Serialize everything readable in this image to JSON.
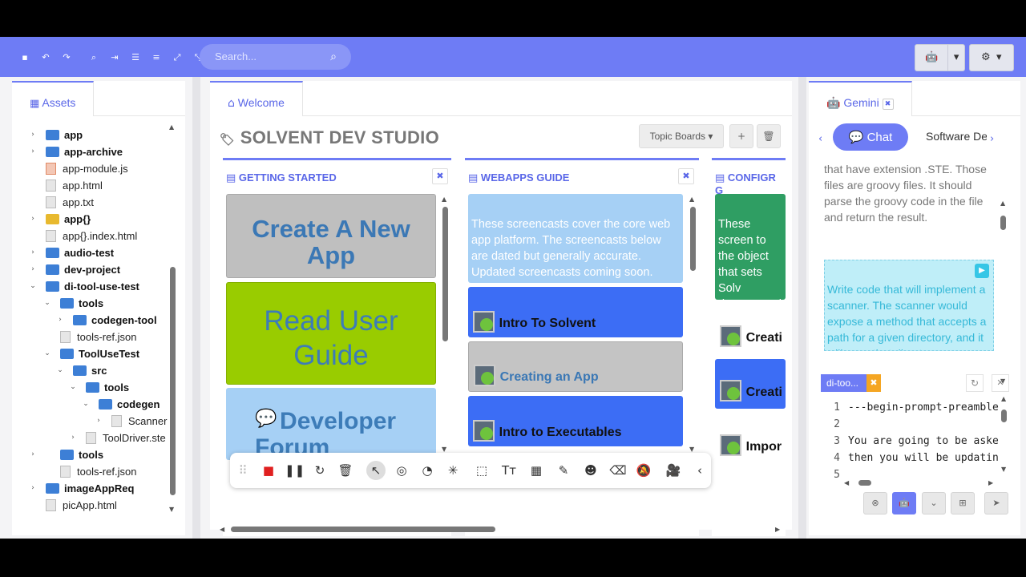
{
  "toolbar": {
    "icons": [
      "save-icon",
      "undo-icon",
      "redo-icon",
      "find-icon",
      "indent-icon",
      "align-left-icon",
      "align-justify-icon",
      "expand-icon",
      "collapse-icon"
    ],
    "icon_glyphs": [
      "▪",
      "↶",
      "↷",
      "⌕",
      "⇥",
      "☰",
      "≡",
      "⤢",
      "⤡"
    ],
    "search_placeholder": "Search...",
    "android_glyph": "🤖",
    "caret": "▾",
    "gear_glyph": "⚙"
  },
  "assets": {
    "tab_label": "Assets",
    "tree": [
      {
        "label": "app",
        "type": "folder",
        "bold": true,
        "arrow": "›"
      },
      {
        "label": "app-archive",
        "type": "folder",
        "bold": true,
        "arrow": "›"
      },
      {
        "label": "app-module.js",
        "type": "js",
        "bold": false,
        "arrow": ""
      },
      {
        "label": "app.html",
        "type": "file",
        "bold": false,
        "arrow": ""
      },
      {
        "label": "app.txt",
        "type": "file",
        "bold": false,
        "arrow": ""
      },
      {
        "label": "app{}",
        "type": "folder-yellow",
        "bold": true,
        "arrow": "›"
      },
      {
        "label": "app{}.index.html",
        "type": "file",
        "bold": false,
        "arrow": ""
      },
      {
        "label": "audio-test",
        "type": "folder",
        "bold": true,
        "arrow": "›"
      },
      {
        "label": "dev-project",
        "type": "folder",
        "bold": true,
        "arrow": "›"
      },
      {
        "label": "di-tool-use-test",
        "type": "folder",
        "bold": true,
        "arrow": "⌄"
      },
      {
        "label": "tools",
        "type": "folder",
        "bold": true,
        "arrow": "⌄"
      },
      {
        "label": "codegen-tool",
        "type": "folder",
        "bold": true,
        "arrow": "›"
      },
      {
        "label": "tools-ref.json",
        "type": "file",
        "bold": false,
        "arrow": ""
      },
      {
        "label": "ToolUseTest",
        "type": "folder",
        "bold": true,
        "arrow": "⌄"
      },
      {
        "label": "src",
        "type": "folder",
        "bold": true,
        "arrow": "⌄"
      },
      {
        "label": "tools",
        "type": "folder",
        "bold": true,
        "arrow": "⌄"
      },
      {
        "label": "codegen",
        "type": "folder",
        "bold": true,
        "arrow": "⌄"
      },
      {
        "label": "Scanner",
        "type": "file",
        "bold": false,
        "arrow": "›"
      },
      {
        "label": "ToolDriver.ste",
        "type": "file",
        "bold": false,
        "arrow": "›"
      },
      {
        "label": "tools",
        "type": "folder",
        "bold": true,
        "arrow": "›"
      },
      {
        "label": "tools-ref.json",
        "type": "file",
        "bold": false,
        "arrow": ""
      },
      {
        "label": "imageAppReq",
        "type": "folder",
        "bold": true,
        "arrow": "›"
      },
      {
        "label": "picApp.html",
        "type": "file",
        "bold": false,
        "arrow": ""
      }
    ]
  },
  "welcome": {
    "tab_label": "Welcome",
    "title": "SOLVENT DEV STUDIO",
    "topic_boards": "Topic Boards ▾",
    "add_glyph": "+",
    "delete_glyph": "🗑",
    "boards": [
      {
        "title": "GETTING STARTED"
      },
      {
        "title": "WEBAPPS GUIDE"
      },
      {
        "title": "CONFIGR G"
      }
    ],
    "close_glyph": "✖",
    "getting_started_cards": [
      "Create A New App",
      "Read User Guide",
      "Developer Forum"
    ],
    "webapps_intro": "These screencasts cover the core web app platform. The screencasts below are dated but generally accurate. Updated screencasts coming soon.",
    "webapps_cards": [
      "Intro To Solvent",
      "Creating an App",
      "Intro to Executables"
    ],
    "configr_intro": "These screen to the object that sets Solv documentatio information.",
    "configr_cards": [
      "Creati",
      "Creati",
      "Impor"
    ]
  },
  "float_toolbar": {
    "glyphs": [
      "⠿",
      "■",
      "❚❚",
      "↻",
      "🗑",
      "↖",
      "◎",
      "◔",
      "✳",
      "⬚",
      "Tт",
      "▦",
      "✎",
      "☻",
      "⌫",
      "🔕",
      "🎥",
      "‹"
    ],
    "names": [
      "drag-handle-icon",
      "stop-record-icon",
      "pause-icon",
      "restart-icon",
      "trash-icon",
      "pointer-icon",
      "highlight-click-icon",
      "spotlight-icon",
      "sparkle-cursor-icon",
      "select-region-icon",
      "text-tool-icon",
      "blur-icon",
      "pen-icon",
      "emoji-icon",
      "eraser-icon",
      "mute-notifications-icon",
      "camera-icon",
      "collapse-toolbar-icon"
    ]
  },
  "gemini": {
    "tab_label": "Gemini",
    "chat_label": "Chat",
    "software_tab": "Software De",
    "message": "that have extension .STE. Those files are groovy files. It should parse the groovy code in the file and return the result.",
    "prompt": "Write code that will implement a scanner. The scanner would expose a method that accepts a path for a given directory, and it will scan that director",
    "file_tab": "di-too...",
    "code_lines": [
      {
        "n": "1",
        "t": "---begin-prompt-preamble"
      },
      {
        "n": "2",
        "t": ""
      },
      {
        "n": "3",
        "t": "You are going to be aske"
      },
      {
        "n": "4",
        "t": "then you will be updatin"
      },
      {
        "n": "5",
        "t": ""
      }
    ]
  }
}
